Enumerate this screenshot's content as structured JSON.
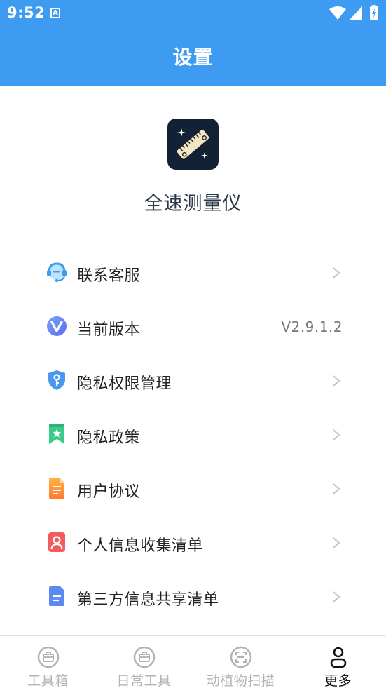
{
  "status_bar": {
    "time": "9:52",
    "icons": [
      "text-a-icon",
      "wifi-icon",
      "signal-icon",
      "battery-charging-icon"
    ]
  },
  "header": {
    "title": "设置",
    "background_color": "#3e9bf2"
  },
  "app": {
    "name": "全速测量仪",
    "logo_icon": "ruler-sparkle-icon"
  },
  "settings": {
    "items": [
      {
        "label": "联系客服",
        "icon": "customer-service-icon",
        "chevron": true
      },
      {
        "label": "当前版本",
        "icon": "version-v-icon",
        "value": "V2.9.1.2",
        "chevron": false
      },
      {
        "label": "隐私权限管理",
        "icon": "shield-key-icon",
        "chevron": true
      },
      {
        "label": "隐私政策",
        "icon": "bookmark-star-icon",
        "chevron": true
      },
      {
        "label": "用户协议",
        "icon": "document-icon",
        "chevron": true
      },
      {
        "label": "个人信息收集清单",
        "icon": "person-card-icon",
        "chevron": true
      },
      {
        "label": "第三方信息共享清单",
        "icon": "file-lines-icon",
        "chevron": true
      }
    ]
  },
  "bottom_nav": {
    "items": [
      {
        "label": "工具箱",
        "icon": "toolbox-icon",
        "active": false
      },
      {
        "label": "日常工具",
        "icon": "toolbox-icon",
        "active": false
      },
      {
        "label": "动植物扫描",
        "icon": "scan-icon",
        "active": false
      },
      {
        "label": "更多",
        "icon": "user-icon",
        "active": true
      }
    ],
    "active_color": "#111111",
    "inactive_color": "#b3b3b3"
  }
}
